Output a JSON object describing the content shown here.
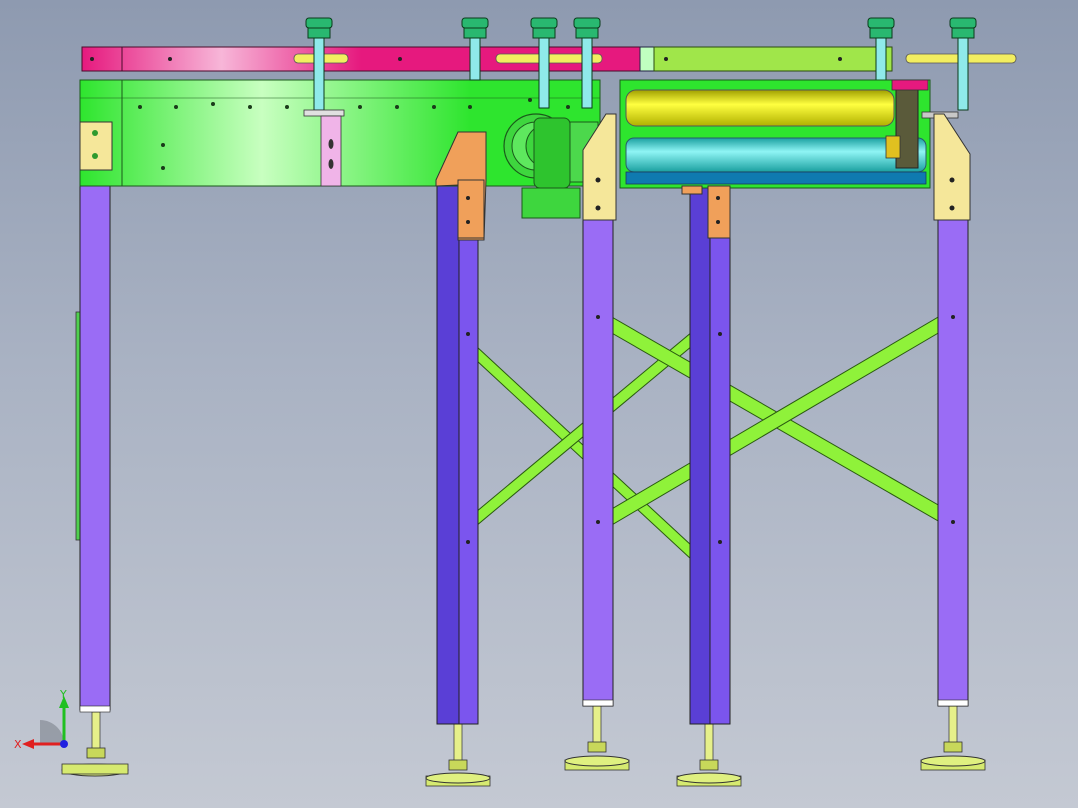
{
  "viewport": {
    "background_top": "#8e9ab0",
    "background_bottom": "#c4c9d3"
  },
  "colors": {
    "frame_green": "#2ee52e",
    "frame_green_light": "#c8ffc0",
    "rail_magenta": "#e6197e",
    "rail_lime": "#a0e64a",
    "leg_purple": "#9a6cf5",
    "leg_dark": "#5a3fd6",
    "bracket_yellow": "#f5e79a",
    "bracket_orange": "#f0a05a",
    "brace_green": "#8ff23a",
    "roller_yellow": "#f2f200",
    "roller_cyan": "#41e6e6",
    "foot_yellow": "#dff080",
    "knob_green": "#29b870",
    "motor_green": "#3ed63e"
  },
  "axis_triad": {
    "x_label": "X",
    "y_label": "Y",
    "x_color": "#e02020",
    "y_color": "#20c020",
    "z_color": "#2020e0"
  },
  "icons": [
    "axis-triad-icon"
  ]
}
